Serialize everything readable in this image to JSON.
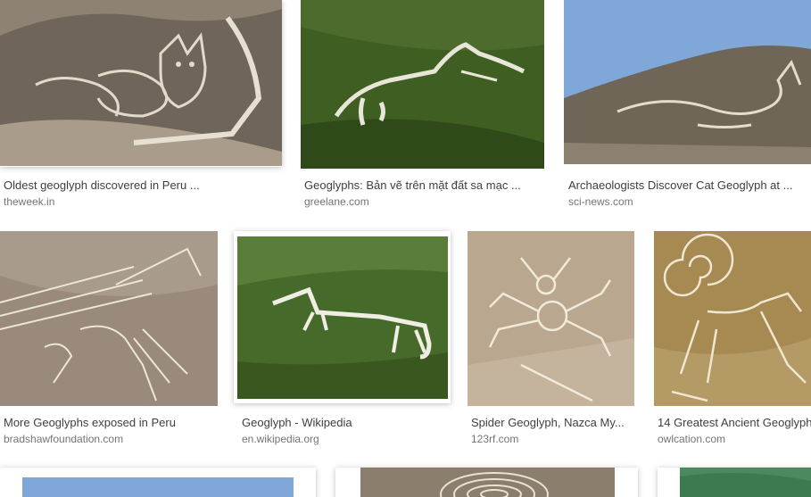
{
  "results": [
    {
      "title": "Oldest geoglyph discovered in Peru ...",
      "source": "theweek.in",
      "image": "cat-geoglyph-hillside"
    },
    {
      "title": "Geoglyphs: Bản vẽ trên mặt đất sa mạc ...",
      "source": "greelane.com",
      "image": "white-horse-green-hill"
    },
    {
      "title": "Archaeologists Discover Cat Geoglyph at ...",
      "source": "sci-news.com",
      "image": "cat-geoglyph-blue-sky"
    },
    {
      "title": "More Geoglyphs exposed in Peru",
      "source": "bradshawfoundation.com",
      "image": "condor-geoglyph"
    },
    {
      "title": "Geoglyph - Wikipedia",
      "source": "en.wikipedia.org",
      "image": "white-horse-wikipedia"
    },
    {
      "title": "Spider Geoglyph, Nazca My...",
      "source": "123rf.com",
      "image": "spider-geoglyph"
    },
    {
      "title": "14 Greatest Ancient Geoglyph",
      "source": "owlcation.com",
      "image": "monkey-spiral-geoglyph"
    },
    {
      "title": "",
      "source": "",
      "image": "desert-blue-sky-partial"
    },
    {
      "title": "",
      "source": "",
      "image": "spiral-partial"
    },
    {
      "title": "",
      "source": "",
      "image": "green-partial"
    }
  ],
  "colors": {
    "caption": "#3c4043",
    "source": "#70757a",
    "desert": "#9a8a78",
    "green": "#3f5e22",
    "sky": "#7fa7d8"
  }
}
